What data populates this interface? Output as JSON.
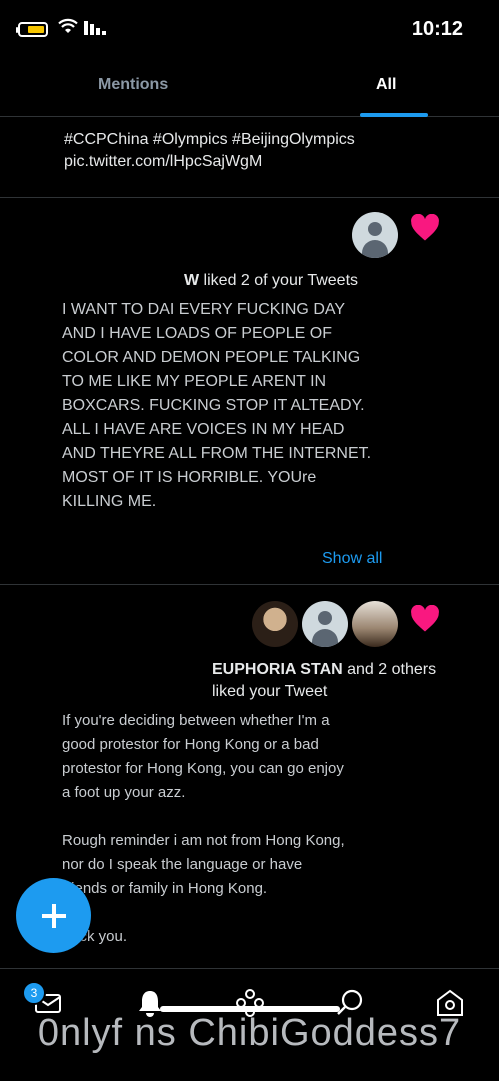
{
  "status_bar": {
    "time": "10:12"
  },
  "tabs": {
    "all": "All",
    "mentions": "Mentions"
  },
  "notifications": [
    {
      "type": "partial_tweet",
      "text": "#CCPChina #Olympics #BeijingOlympics\npic.twitter.com/lHpcSajWgM"
    },
    {
      "type": "like",
      "actor": "W",
      "action": " liked 2 of your Tweets",
      "text": "I WANT TO DAI EVERY FUCKING DAY\nAND I HAVE LOADS OF PEOPLE OF\nCOLOR AND DEMON PEOPLE TALKING\nTO ME LIKE MY PEOPLE ARENT IN\nBOXCARS. FUCKING STOP IT ALTEADY.\nALL I HAVE ARE VOICES IN MY HEAD\nAND THEYRE ALL FROM THE INTERNET.\nMOST OF IT IS HORRIBLE. YOUre\nKILLING ME.",
      "show_all": "Show all"
    },
    {
      "type": "like",
      "actor": "EUPHORIA STAN",
      "action": " and 2 others liked your Tweet",
      "text": "If you're deciding between whether I'm a\ngood protestor for Hong Kong or a bad\nprotestor for Hong Kong, you can go enjoy\na foot up your azz.\n\nRough reminder i am not from Hong Kong,\nnor do I speak the language or have\nfriends or family in Hong Kong.\n\nFuck you."
    }
  ],
  "fab": {
    "icon": "plus-icon"
  },
  "nav": {
    "items": [
      "messages-icon",
      "bell-icon",
      "spaces-icon",
      "search-icon",
      "home-icon"
    ],
    "messages_badge": "3"
  },
  "watermark": "0nlyf ns ChibiGoddess7",
  "colors": {
    "accent": "#1d9bf0",
    "heart": "#f91880",
    "background": "#000000"
  }
}
